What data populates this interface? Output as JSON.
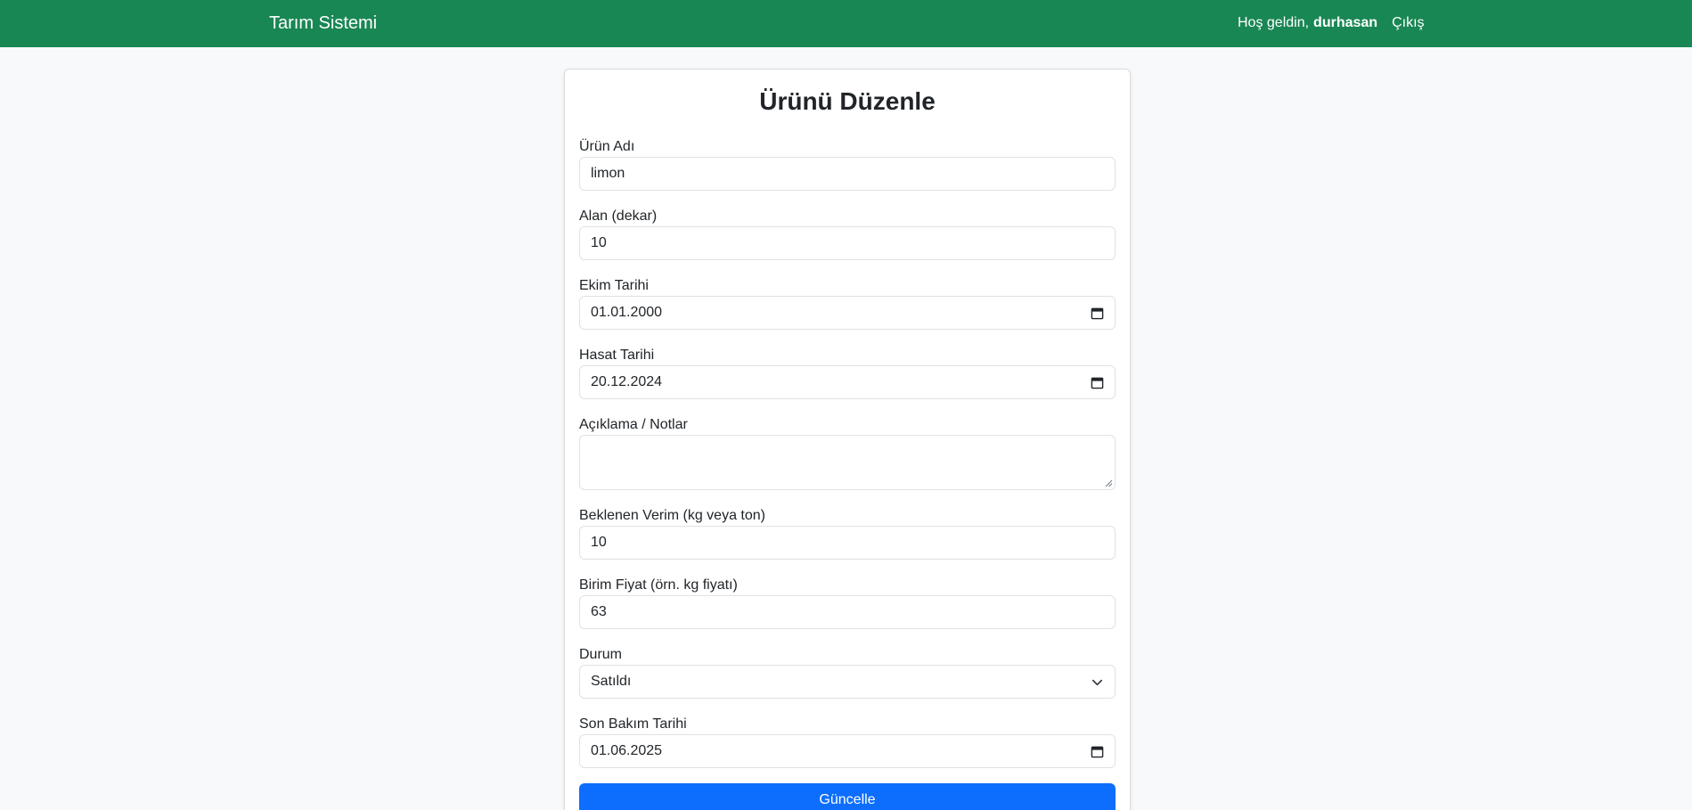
{
  "navbar": {
    "brand": "Tarım Sistemi",
    "greeting": "Hoş geldin,",
    "username": "durhasan",
    "logout": "Çıkış"
  },
  "form": {
    "title": "Ürünü Düzenle",
    "product_name_label": "Ürün Adı",
    "product_name_value": "limon",
    "area_label": "Alan (dekar)",
    "area_value": "10",
    "planting_date_label": "Ekim Tarihi",
    "planting_date_value": "01.01.2000",
    "harvest_date_label": "Hasat Tarihi",
    "harvest_date_value": "20.12.2024",
    "notes_label": "Açıklama / Notlar",
    "notes_value": "",
    "expected_yield_label": "Beklenen Verim (kg veya ton)",
    "expected_yield_value": "10",
    "unit_price_label": "Birim Fiyat (örn. kg fiyatı)",
    "unit_price_value": "63",
    "status_label": "Durum",
    "status_value": "Satıldı",
    "last_care_date_label": "Son Bakım Tarihi",
    "last_care_date_value": "01.06.2025",
    "submit_label": "Güncelle"
  },
  "colors": {
    "navbar": "#198754",
    "primary_button": "#0d6efd",
    "background": "#f8f9fa"
  },
  "icons": {
    "date_picker": "calendar-icon",
    "select": "chevron-down-icon"
  }
}
